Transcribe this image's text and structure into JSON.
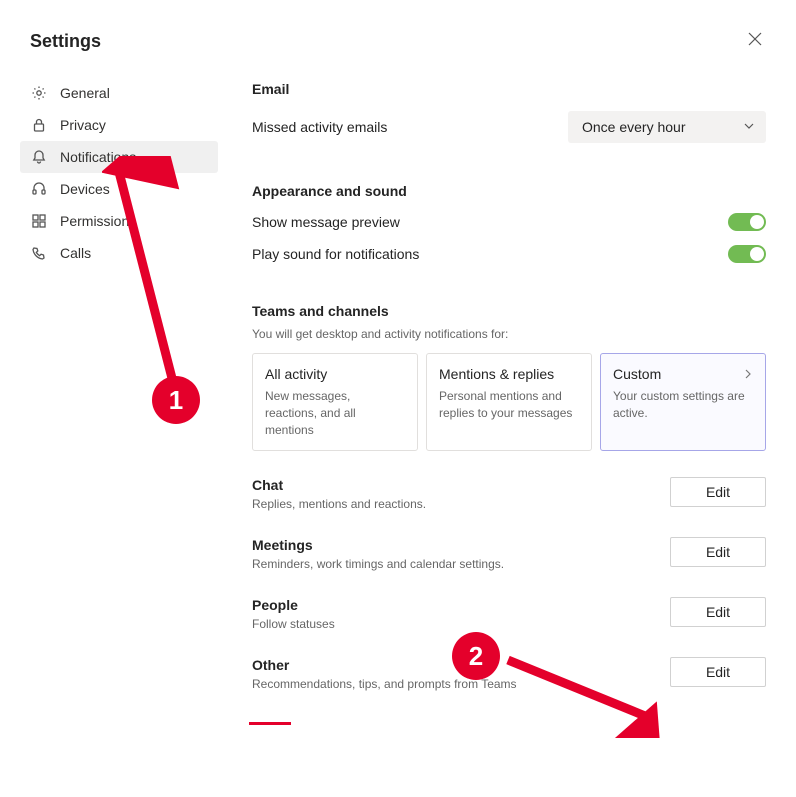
{
  "title": "Settings",
  "sidebar": {
    "items": [
      {
        "label": "General"
      },
      {
        "label": "Privacy"
      },
      {
        "label": "Notifications"
      },
      {
        "label": "Devices"
      },
      {
        "label": "Permissions"
      },
      {
        "label": "Calls"
      }
    ]
  },
  "email": {
    "heading": "Email",
    "missed_label": "Missed activity emails",
    "missed_value": "Once every hour"
  },
  "appearance": {
    "heading": "Appearance and sound",
    "preview_label": "Show message preview",
    "sound_label": "Play sound for notifications"
  },
  "teams": {
    "heading": "Teams and channels",
    "note": "You will get desktop and activity notifications for:",
    "cards": [
      {
        "title": "All activity",
        "desc": "New messages, reactions, and all mentions"
      },
      {
        "title": "Mentions & replies",
        "desc": "Personal mentions and replies to your messages"
      },
      {
        "title": "Custom",
        "desc": "Your custom settings are active."
      }
    ]
  },
  "groups": [
    {
      "title": "Chat",
      "desc": "Replies, mentions and reactions.",
      "btn": "Edit"
    },
    {
      "title": "Meetings",
      "desc": "Reminders, work timings and calendar settings.",
      "btn": "Edit"
    },
    {
      "title": "People",
      "desc": "Follow statuses",
      "btn": "Edit"
    },
    {
      "title": "Other",
      "desc": "Recommendations, tips, and prompts from Teams",
      "btn": "Edit"
    }
  ],
  "annotations": {
    "badge1": "1",
    "badge2": "2"
  }
}
